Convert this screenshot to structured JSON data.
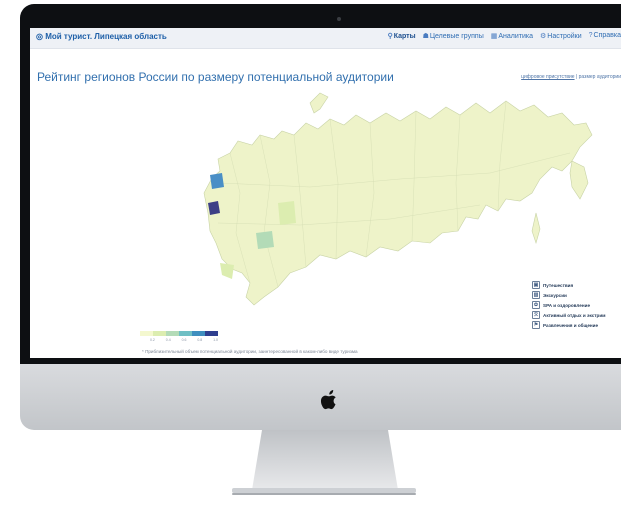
{
  "app": {
    "brand": "Мой турист. Липецкая область",
    "brand_icon": "globe-icon"
  },
  "nav": {
    "items": [
      {
        "label": "Карты",
        "icon": "map-pin-icon",
        "active": true
      },
      {
        "label": "Целевые группы",
        "icon": "people-icon",
        "active": false
      },
      {
        "label": "Аналитика",
        "icon": "chart-icon",
        "active": false
      },
      {
        "label": "Настройки",
        "icon": "gears-icon",
        "active": false
      },
      {
        "label": "Справка",
        "icon": "question-icon",
        "active": false
      }
    ]
  },
  "page": {
    "title": "Рейтинг регионов России по размеру потенциальной аудитории",
    "toggle_a": "цифровое присутствие",
    "toggle_sep": "|",
    "toggle_b": "размер аудитории"
  },
  "legend": {
    "items": [
      {
        "label": "Путешествия",
        "icon": "luggage-icon"
      },
      {
        "label": "Экскурсии",
        "icon": "building-icon"
      },
      {
        "label": "SPA и оздоровление",
        "icon": "lotus-icon"
      },
      {
        "label": "Активный отдых и экстрим",
        "icon": "runner-icon"
      },
      {
        "label": "Развлечения и общение",
        "icon": "flag-icon"
      }
    ]
  },
  "scale": {
    "ticks": [
      "0.2",
      "0.4",
      "0.6",
      "0.8",
      "1.0"
    ],
    "colors": [
      "#f4f8cf",
      "#dcedb0",
      "#b3dbb7",
      "#6fbfc4",
      "#3f8fbf",
      "#2f3f8f"
    ]
  },
  "footnote": "* Приблизительный объем потенциальной аудитории, заинтересованной в каком-либо виде туризма",
  "colors": {
    "accent": "#1d5fa8",
    "map_base": "#eef3c9",
    "highlight_dark": "#3d3f86",
    "highlight_mid": "#4a8fc6"
  }
}
